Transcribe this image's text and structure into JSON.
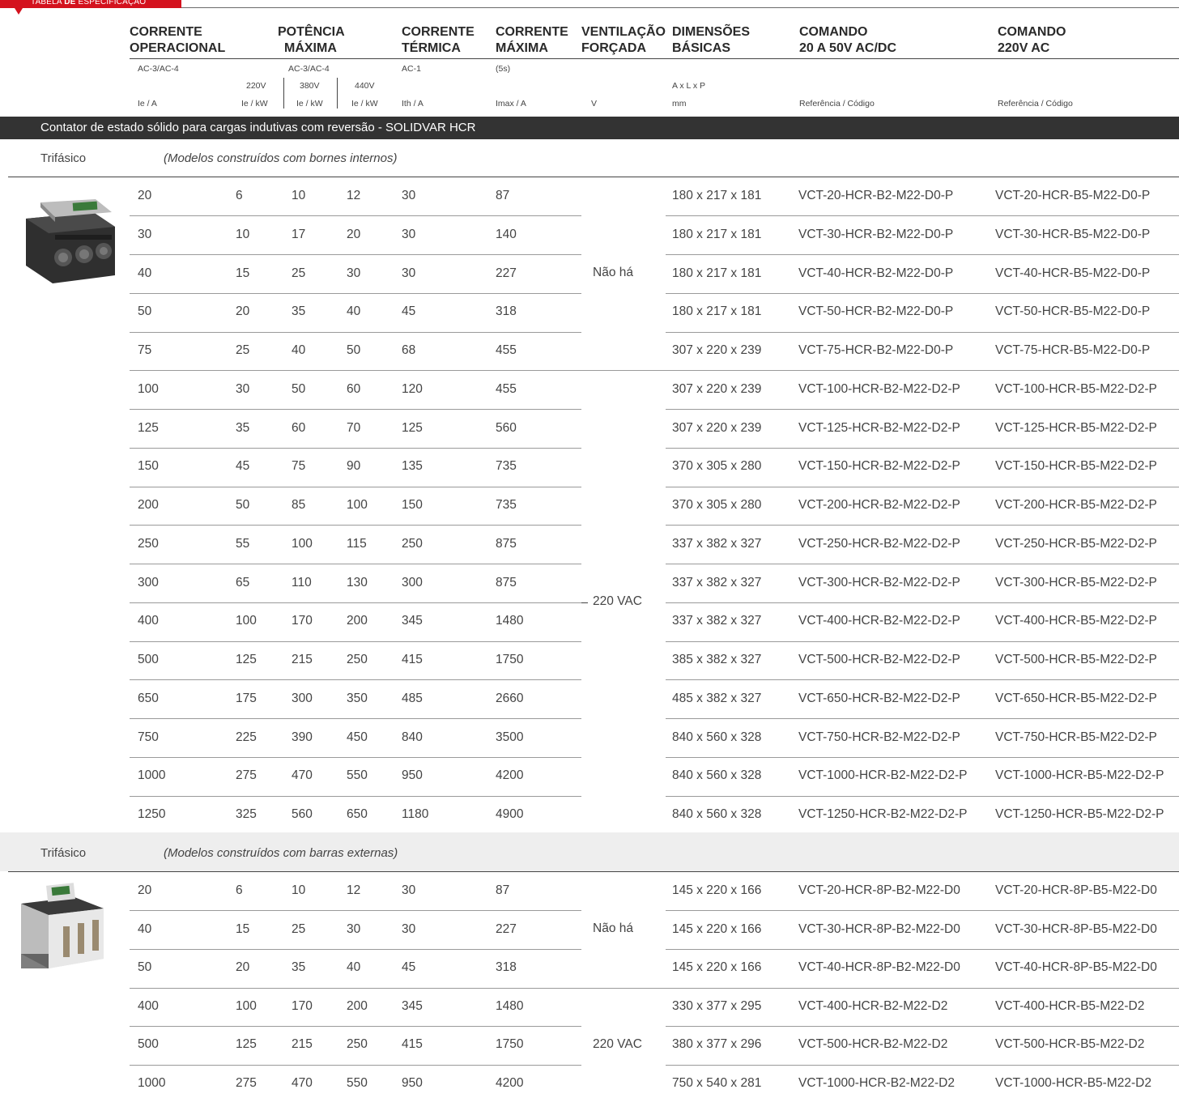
{
  "tag": {
    "prefix": "TABELA ",
    "bold": "DE",
    "suffix": " ESPECIFICAÇÃO"
  },
  "headers": {
    "corrente_op": {
      "l1": "CORRENTE",
      "l2": "OPERACIONAL",
      "sub": "AC-3/AC-4",
      "unit": "Ie / A"
    },
    "potencia": {
      "l1": "POTÊNCIA",
      "l2": "MÁXIMA",
      "sub": "AC-3/AC-4",
      "v220": "220V",
      "v380": "380V",
      "v440": "440V",
      "unit220": "Ie / kW",
      "unit380": "Ie / kW",
      "unit440": "Ie / kW"
    },
    "termica": {
      "l1": "CORRENTE",
      "l2": "TÉRMICA",
      "sub": "AC-1",
      "unit": "Ith / A"
    },
    "maxima": {
      "l1": "CORRENTE",
      "l2": "MÁXIMA",
      "sub": "(5s)",
      "unit": "Imax / A"
    },
    "ventilacao": {
      "l1": "VENTILAÇÃO",
      "l2": "FORÇADA",
      "unit": "V"
    },
    "dimensoes": {
      "l1": "DIMENSÕES",
      "l2": "BÁSICAS",
      "sub": "A x L x P",
      "unit": "mm"
    },
    "cmd20": {
      "l1": "COMANDO",
      "l2": "20 A 50V AC/DC",
      "unit": "Referência / Código"
    },
    "cmd220": {
      "l1": "COMANDO",
      "l2": "220V AC",
      "unit": "Referência / Código"
    }
  },
  "section_title": "Contator de estado sólido para cargas indutivas com reversão - SOLIDVAR HCR",
  "group1": {
    "label": "Trifásico",
    "note": "(Modelos construídos com bornes internos)",
    "vent_a": "Não há",
    "vent_b": "220 VAC",
    "rows": [
      [
        "20",
        "6",
        "10",
        "12",
        "30",
        "87",
        "180 x 217 x 181",
        "VCT-20-HCR-B2-M22-D0-P",
        "VCT-20-HCR-B5-M22-D0-P"
      ],
      [
        "30",
        "10",
        "17",
        "20",
        "30",
        "140",
        "180 x 217 x 181",
        "VCT-30-HCR-B2-M22-D0-P",
        "VCT-30-HCR-B5-M22-D0-P"
      ],
      [
        "40",
        "15",
        "25",
        "30",
        "30",
        "227",
        "180 x 217 x 181",
        "VCT-40-HCR-B2-M22-D0-P",
        "VCT-40-HCR-B5-M22-D0-P"
      ],
      [
        "50",
        "20",
        "35",
        "40",
        "45",
        "318",
        "180 x 217 x 181",
        "VCT-50-HCR-B2-M22-D0-P",
        "VCT-50-HCR-B5-M22-D0-P"
      ],
      [
        "75",
        "25",
        "40",
        "50",
        "68",
        "455",
        "307 x 220 x 239",
        "VCT-75-HCR-B2-M22-D0-P",
        "VCT-75-HCR-B5-M22-D0-P"
      ],
      [
        "100",
        "30",
        "50",
        "60",
        "120",
        "455",
        "307 x 220 x 239",
        "VCT-100-HCR-B2-M22-D2-P",
        "VCT-100-HCR-B5-M22-D2-P"
      ],
      [
        "125",
        "35",
        "60",
        "70",
        "125",
        "560",
        "307 x 220 x 239",
        "VCT-125-HCR-B2-M22-D2-P",
        "VCT-125-HCR-B5-M22-D2-P"
      ],
      [
        "150",
        "45",
        "75",
        "90",
        "135",
        "735",
        "370 x 305 x 280",
        "VCT-150-HCR-B2-M22-D2-P",
        "VCT-150-HCR-B5-M22-D2-P"
      ],
      [
        "200",
        "50",
        "85",
        "100",
        "150",
        "735",
        "370 x 305 x 280",
        "VCT-200-HCR-B2-M22-D2-P",
        "VCT-200-HCR-B5-M22-D2-P"
      ],
      [
        "250",
        "55",
        "100",
        "115",
        "250",
        "875",
        "337 x 382 x 327",
        "VCT-250-HCR-B2-M22-D2-P",
        "VCT-250-HCR-B5-M22-D2-P"
      ],
      [
        "300",
        "65",
        "110",
        "130",
        "300",
        "875",
        "337 x 382 x 327",
        "VCT-300-HCR-B2-M22-D2-P",
        "VCT-300-HCR-B5-M22-D2-P"
      ],
      [
        "400",
        "100",
        "170",
        "200",
        "345",
        "1480",
        "337 x 382 x 327",
        "VCT-400-HCR-B2-M22-D2-P",
        "VCT-400-HCR-B5-M22-D2-P"
      ],
      [
        "500",
        "125",
        "215",
        "250",
        "415",
        "1750",
        "385 x 382 x 327",
        "VCT-500-HCR-B2-M22-D2-P",
        "VCT-500-HCR-B5-M22-D2-P"
      ],
      [
        "650",
        "175",
        "300",
        "350",
        "485",
        "2660",
        "485 x 382 x 327",
        "VCT-650-HCR-B2-M22-D2-P",
        "VCT-650-HCR-B5-M22-D2-P"
      ],
      [
        "750",
        "225",
        "390",
        "450",
        "840",
        "3500",
        "840 x 560 x 328",
        "VCT-750-HCR-B2-M22-D2-P",
        "VCT-750-HCR-B5-M22-D2-P"
      ],
      [
        "1000",
        "275",
        "470",
        "550",
        "950",
        "4200",
        "840 x 560 x 328",
        "VCT-1000-HCR-B2-M22-D2-P",
        "VCT-1000-HCR-B5-M22-D2-P"
      ],
      [
        "1250",
        "325",
        "560",
        "650",
        "1180",
        "4900",
        "840 x 560 x 328",
        "VCT-1250-HCR-B2-M22-D2-P",
        "VCT-1250-HCR-B5-M22-D2-P"
      ]
    ]
  },
  "group2": {
    "label": "Trifásico",
    "note": "(Modelos construídos com barras externas)",
    "vent_a": "Não há",
    "vent_b": "220 VAC",
    "rows": [
      [
        "20",
        "6",
        "10",
        "12",
        "30",
        "87",
        "145 x 220 x 166",
        "VCT-20-HCR-8P-B2-M22-D0",
        "VCT-20-HCR-8P-B5-M22-D0"
      ],
      [
        "40",
        "15",
        "25",
        "30",
        "30",
        "227",
        "145 x 220 x 166",
        "VCT-30-HCR-8P-B2-M22-D0",
        "VCT-30-HCR-8P-B5-M22-D0"
      ],
      [
        "50",
        "20",
        "35",
        "40",
        "45",
        "318",
        "145 x 220 x 166",
        "VCT-40-HCR-8P-B2-M22-D0",
        "VCT-40-HCR-8P-B5-M22-D0"
      ],
      [
        "400",
        "100",
        "170",
        "200",
        "345",
        "1480",
        "330 x 377 x 295",
        "VCT-400-HCR-B2-M22-D2",
        "VCT-400-HCR-B5-M22-D2"
      ],
      [
        "500",
        "125",
        "215",
        "250",
        "415",
        "1750",
        "380 x 377 x 296",
        "VCT-500-HCR-B2-M22-D2",
        "VCT-500-HCR-B5-M22-D2"
      ],
      [
        "1000",
        "275",
        "470",
        "550",
        "950",
        "4200",
        "750 x 540 x 281",
        "VCT-1000-HCR-B2-M22-D2",
        "VCT-1000-HCR-B5-M22-D2"
      ]
    ]
  },
  "icons": {
    "product1": "solid-state-contactor-image",
    "product2": "solid-state-contactor-bar-image"
  }
}
